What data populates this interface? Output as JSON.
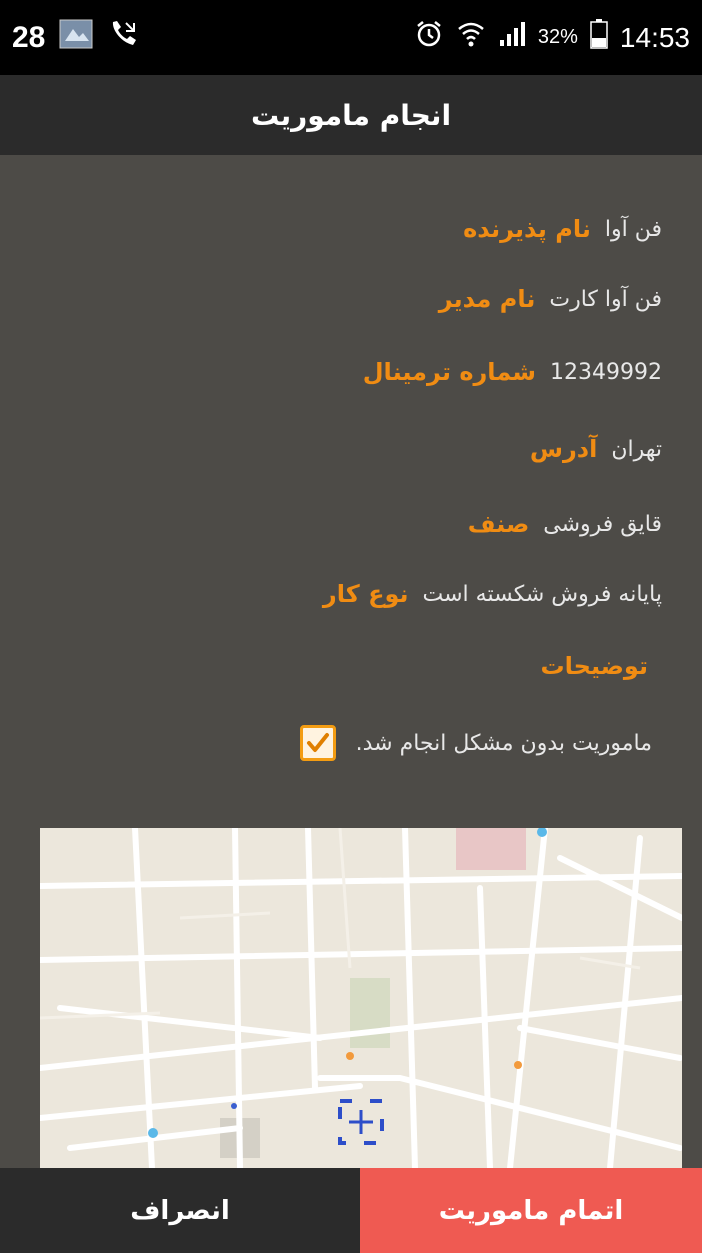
{
  "status": {
    "notif_count": "28",
    "battery_percent": "32%",
    "time": "14:53"
  },
  "appbar": {
    "title": "انجام ماموریت"
  },
  "fields": [
    {
      "label": "نام پذیرنده",
      "value": "فن آوا"
    },
    {
      "label": "نام مدیر",
      "value": "فن آوا کارت"
    },
    {
      "label": "شماره ترمینال",
      "value": "12349992"
    },
    {
      "label": "آدرس",
      "value": "تهران"
    },
    {
      "label": "صنف",
      "value": "قایق فروشی"
    },
    {
      "label": "نوع کار",
      "value": "پایانه فروش شکسته است"
    },
    {
      "label": "توضیحات",
      "value": ""
    }
  ],
  "checkbox": {
    "label": "ماموریت بدون مشکل انجام شد.",
    "checked": true
  },
  "buttons": {
    "cancel": "انصراف",
    "done": "اتمام ماموریت"
  },
  "colors": {
    "accent": "#f08c13",
    "done_button": "#ef5a52",
    "background": "#4d4b47"
  }
}
